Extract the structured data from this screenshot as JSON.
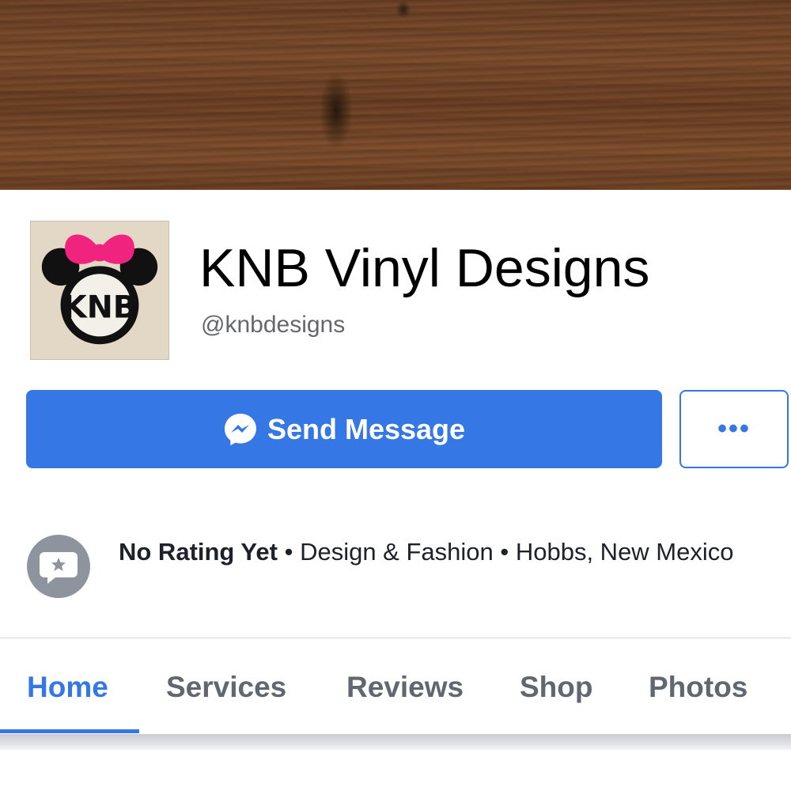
{
  "page": {
    "name": "KNB Vinyl Designs",
    "handle": "@knbdesigns",
    "avatar_text": "KNB"
  },
  "actions": {
    "send_message_label": "Send Message",
    "more_label": "•••"
  },
  "info": {
    "rating": "No Rating Yet",
    "separator": " • ",
    "category": "Design & Fashion",
    "location": "Hobbs, New Mexico"
  },
  "tabs": [
    {
      "label": "Home",
      "active": true
    },
    {
      "label": "Services",
      "active": false
    },
    {
      "label": "Reviews",
      "active": false
    },
    {
      "label": "Shop",
      "active": false
    },
    {
      "label": "Photos",
      "active": false
    }
  ],
  "icons": {
    "messenger": "messenger-icon",
    "rating": "rating-speech-bubble-icon",
    "more": "more-dots-icon"
  },
  "colors": {
    "accent": "#3578e5",
    "bow": "#f0237e",
    "tab_inactive": "#606770",
    "rating_icon_bg": "#8d949e"
  }
}
